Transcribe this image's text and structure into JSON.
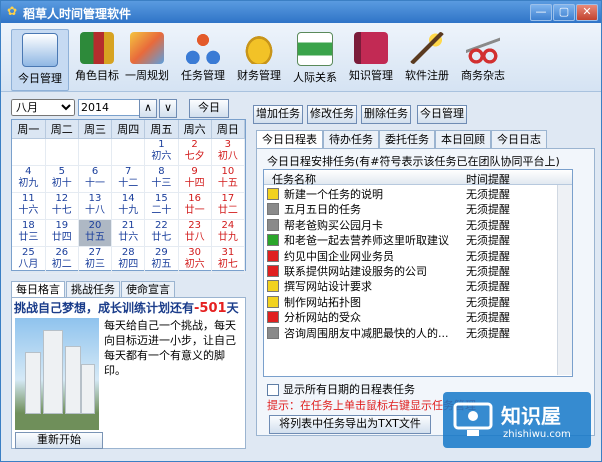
{
  "window": {
    "title": "稻草人时间管理软件",
    "controls": [
      "—",
      "▢",
      "✕"
    ]
  },
  "toolbar": {
    "items": [
      {
        "label": "今日管理",
        "icon": "calendar-grid-icon",
        "selected": true
      },
      {
        "label": "角色目标",
        "icon": "books-icon"
      },
      {
        "label": "一周规划",
        "icon": "cards-icon"
      },
      {
        "label": "任务管理",
        "icon": "org-chart-icon"
      },
      {
        "label": "财务管理",
        "icon": "coins-icon"
      },
      {
        "label": "人际关系",
        "icon": "contacts-icon"
      },
      {
        "label": "知识管理",
        "icon": "book-icon"
      },
      {
        "label": "软件注册",
        "icon": "magic-wand-icon"
      },
      {
        "label": "商务杂志",
        "icon": "scissors-icon"
      }
    ]
  },
  "calendar": {
    "month": "八月",
    "year": "2014",
    "prev": "∧",
    "next": "∨",
    "today_button": "今日",
    "weekdays": [
      "周一",
      "周二",
      "周三",
      "周四",
      "周五",
      "周六",
      "周日"
    ],
    "weeks": [
      [
        null,
        null,
        null,
        null,
        {
          "d": "1",
          "l": "初六"
        },
        {
          "d": "2",
          "l": "七夕",
          "we": true
        },
        {
          "d": "3",
          "l": "初八",
          "we": true
        }
      ],
      [
        {
          "d": "4",
          "l": "初九"
        },
        {
          "d": "5",
          "l": "初十"
        },
        {
          "d": "6",
          "l": "十一"
        },
        {
          "d": "7",
          "l": "十二"
        },
        {
          "d": "8",
          "l": "十三"
        },
        {
          "d": "9",
          "l": "十四",
          "we": true
        },
        {
          "d": "10",
          "l": "十五",
          "we": true
        }
      ],
      [
        {
          "d": "11",
          "l": "十六"
        },
        {
          "d": "12",
          "l": "十七"
        },
        {
          "d": "13",
          "l": "十八"
        },
        {
          "d": "14",
          "l": "十九"
        },
        {
          "d": "15",
          "l": "二十"
        },
        {
          "d": "16",
          "l": "廿一",
          "we": true
        },
        {
          "d": "17",
          "l": "廿二",
          "we": true
        }
      ],
      [
        {
          "d": "18",
          "l": "廿三"
        },
        {
          "d": "19",
          "l": "廿四"
        },
        {
          "d": "20",
          "l": "廿五",
          "today": true
        },
        {
          "d": "21",
          "l": "廿六"
        },
        {
          "d": "22",
          "l": "廿七"
        },
        {
          "d": "23",
          "l": "廿八",
          "we": true
        },
        {
          "d": "24",
          "l": "廿九",
          "we": true
        }
      ],
      [
        {
          "d": "25",
          "l": "八月"
        },
        {
          "d": "26",
          "l": "初二"
        },
        {
          "d": "27",
          "l": "初三"
        },
        {
          "d": "28",
          "l": "初四"
        },
        {
          "d": "29",
          "l": "初五"
        },
        {
          "d": "30",
          "l": "初六",
          "we": true
        },
        {
          "d": "31",
          "l": "初七",
          "we": true
        }
      ]
    ]
  },
  "left_tabs": [
    "每日格言",
    "挑战任务",
    "使命宣言"
  ],
  "motto": {
    "headline_pre": "挑战自己梦想，成长训练计划还有",
    "headline_num": "-501",
    "headline_post": "天",
    "text": "每天给自己一个挑战，每天向目标迈进一小步，让自己每天都有一个有意义的脚印。",
    "restart": "重新开始"
  },
  "actions": [
    "增加任务",
    "修改任务",
    "删除任务",
    "今日管理"
  ],
  "right_tabs": [
    "今日日程表",
    "待办任务",
    "委托任务",
    "本日回顾",
    "今日日志"
  ],
  "schedule": {
    "group_title": "今日日程安排任务(有#符号表示该任务已在团队协同平台上)",
    "columns": [
      "任务名称",
      "时间提醒"
    ],
    "rows": [
      {
        "name": "新建一个任务的说明",
        "remind": "无须提醒",
        "color": "#f2d21f"
      },
      {
        "name": "五月五日的任务",
        "remind": "无须提醒",
        "color": "#8a8a8a"
      },
      {
        "name": "帮老爸购买公园月卡",
        "remind": "无须提醒",
        "color": "#8a8a8a"
      },
      {
        "name": "和老爸一起去营养师这里听取建议",
        "remind": "无须提醒",
        "color": "#2aa52a"
      },
      {
        "name": "约见中国企业网业务员",
        "remind": "无须提醒",
        "color": "#e02020"
      },
      {
        "name": "联系提供网站建设服务的公司",
        "remind": "无须提醒",
        "color": "#e02020"
      },
      {
        "name": "撰写网站设计要求",
        "remind": "无须提醒",
        "color": "#f2d21f"
      },
      {
        "name": "制作网站拓扑图",
        "remind": "无须提醒",
        "color": "#f2d21f"
      },
      {
        "name": "分析网站的受众",
        "remind": "无须提醒",
        "color": "#e02020"
      },
      {
        "name": "咨询周围朋友中减肥最快的人的...",
        "remind": "无须提醒",
        "color": "#8a8a8a"
      }
    ],
    "show_all_label": "显示所有日期的日程表任务",
    "tip": "提示：在任务上单击鼠标右键显示任务管理",
    "export": "将列表中任务导出为TXT文件"
  },
  "watermark": {
    "brand": "知识屋",
    "site": "zhishiwu.com"
  }
}
